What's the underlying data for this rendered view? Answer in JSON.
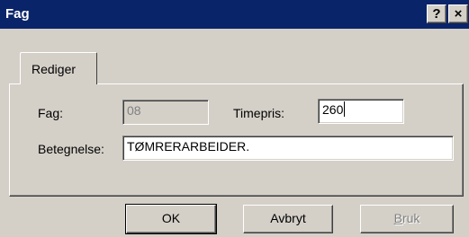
{
  "window": {
    "title": "Fag",
    "help_glyph": "?",
    "close_glyph": "×"
  },
  "tabs": [
    {
      "label": "Rediger",
      "selected": true
    }
  ],
  "form": {
    "fag_label": "Fag:",
    "fag_value": "08",
    "timepris_label": "Timepris:",
    "timepris_value": "260",
    "betegnelse_label": "Betegnelse:",
    "betegnelse_value": "TØMRERARBEIDER."
  },
  "buttons": {
    "ok": "OK",
    "cancel": "Avbryt",
    "apply_first": "B",
    "apply_rest": "ruk"
  },
  "colors": {
    "titlebar": "#0a246a",
    "face": "#d4d0c8",
    "disabled_text": "#808080"
  }
}
